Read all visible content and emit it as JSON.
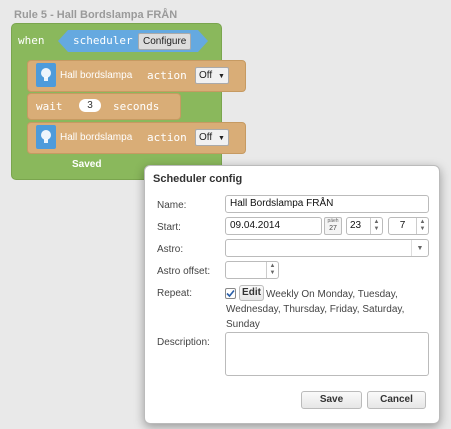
{
  "rule_title": "Rule 5 - Hall Bordslampa FRÅN",
  "blocks": {
    "when_label": "when",
    "scheduler_label": "scheduler",
    "configure_label": "Configure",
    "actions": [
      {
        "device": "Hall bordslampa",
        "action_label": "action",
        "value": "Off"
      },
      {
        "device": "Hall bordslampa",
        "action_label": "action",
        "value": "Off"
      }
    ],
    "wait": {
      "label": "wait",
      "value": "3",
      "unit": "seconds"
    },
    "saved_label": "Saved"
  },
  "dialog": {
    "title": "Scheduler config",
    "name_label": "Name:",
    "name_value": "Hall Bordslampa FRÅN",
    "start_label": "Start:",
    "start_date": "09.04.2014",
    "calendar_month": "päeh",
    "calendar_day": "27",
    "start_hour": "23",
    "start_minute": "7",
    "astro_label": "Astro:",
    "astro_value": "",
    "astro_offset_label": "Astro offset:",
    "astro_offset_value": "",
    "repeat_label": "Repeat:",
    "repeat_checked": true,
    "edit_label": "Edit",
    "repeat_text": "Weekly On Monday, Tuesday, Wednesday, Thursday, Friday, Saturday, Sunday",
    "description_label": "Description:",
    "description_value": "",
    "save_label": "Save",
    "cancel_label": "Cancel"
  }
}
